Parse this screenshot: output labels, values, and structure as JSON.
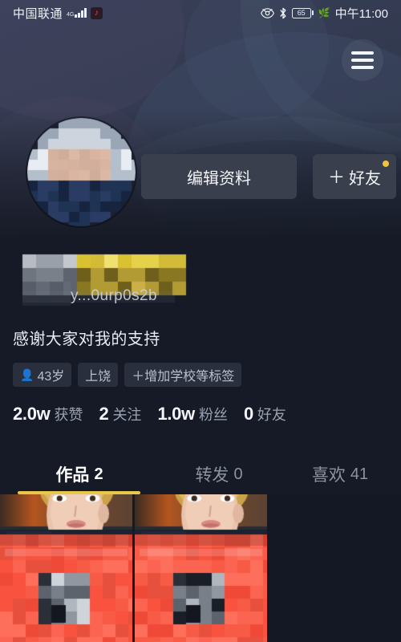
{
  "statusbar": {
    "carrier": "中国联通",
    "network_type": "4G",
    "app_badge_icon": "tiktok-note-icon",
    "eye_icon": "eye-care-icon",
    "bluetooth_icon": "bluetooth-icon",
    "battery_level": "65",
    "power_saver_icon": "leaf-icon",
    "time": "中午11:00"
  },
  "header": {
    "menu_button_icon": "hamburger-menu-icon"
  },
  "profile": {
    "avatar_alt": "user-avatar",
    "display_name_masked": "████████████",
    "user_id": "y...0urp0s2b",
    "bio": "感谢大家对我的支持",
    "buttons": {
      "edit_profile": "编辑资料",
      "add_friend": "好友",
      "add_friend_plus": "＋",
      "badge_color": "#f2c33c"
    },
    "tags": [
      {
        "icon": "person-icon",
        "label": "43岁"
      },
      {
        "icon": "",
        "label": "上饶"
      },
      {
        "icon": "",
        "label": "＋增加学校等标签"
      }
    ],
    "stats": [
      {
        "value": "2.0w",
        "label": "获赞"
      },
      {
        "value": "2",
        "label": "关注"
      },
      {
        "value": "1.0w",
        "label": "粉丝"
      },
      {
        "value": "0",
        "label": "好友"
      }
    ]
  },
  "tabs": [
    {
      "label": "作品",
      "count": "2",
      "active": true
    },
    {
      "label": "转发",
      "count": "0",
      "active": false
    },
    {
      "label": "喜欢",
      "count": "41",
      "active": false
    }
  ],
  "tab_indicator_color": "#e8c84a",
  "grid": {
    "items": [
      {
        "name": "video-thumbnail-1"
      },
      {
        "name": "video-thumbnail-2"
      }
    ]
  },
  "colors": {
    "page_bg": "#161a26",
    "banner_top": "#3a4058",
    "button_bg": "#3a3f4d",
    "tag_bg": "#2a2f3d",
    "accent": "#e8c84a",
    "thumb_overlay": "#fa5340"
  }
}
